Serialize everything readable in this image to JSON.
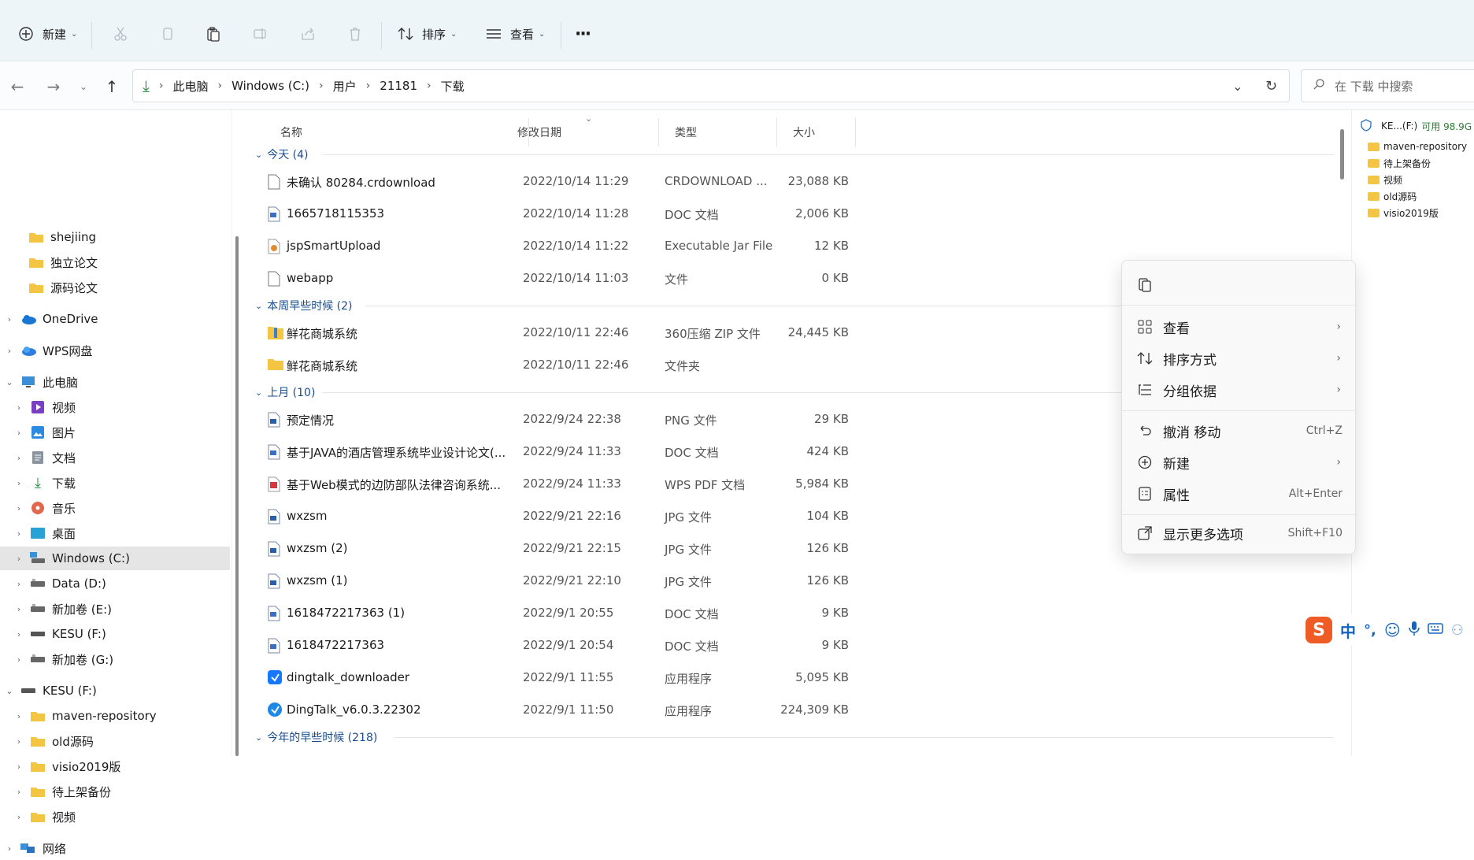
{
  "toolbar": {
    "new_label": "新建",
    "sort_label": "排序",
    "view_label": "查看",
    "more_label": "···"
  },
  "nav": {
    "breadcrumbs": [
      "此电脑",
      "Windows (C:)",
      "用户",
      "21181",
      "下载"
    ],
    "search_placeholder": "在 下载 中搜索"
  },
  "sidebar": {
    "items": [
      {
        "label": "shejiing",
        "icon": "folder-icon"
      },
      {
        "label": "独立论文",
        "icon": "folder-icon"
      },
      {
        "label": "源码论文",
        "icon": "folder-icon"
      },
      {
        "label": "OneDrive",
        "icon": "cloud-icon"
      },
      {
        "label": "WPS网盘",
        "icon": "cloud-icon"
      },
      {
        "label": "此电脑",
        "icon": "computer-icon"
      },
      {
        "label": "视频",
        "icon": "video-icon"
      },
      {
        "label": "图片",
        "icon": "picture-icon"
      },
      {
        "label": "文档",
        "icon": "document-icon"
      },
      {
        "label": "下载",
        "icon": "download-icon"
      },
      {
        "label": "音乐",
        "icon": "music-icon"
      },
      {
        "label": "桌面",
        "icon": "desktop-icon"
      },
      {
        "label": "Windows (C:)",
        "icon": "drive-icon"
      },
      {
        "label": "Data (D:)",
        "icon": "drive-icon"
      },
      {
        "label": "新加卷 (E:)",
        "icon": "drive-icon"
      },
      {
        "label": "KESU  (F:)",
        "icon": "drive-icon"
      },
      {
        "label": "新加卷 (G:)",
        "icon": "drive-icon"
      },
      {
        "label": "KESU  (F:)",
        "icon": "drive-icon"
      },
      {
        "label": "maven-repository",
        "icon": "folder-icon"
      },
      {
        "label": "old源码",
        "icon": "folder-icon"
      },
      {
        "label": "visio2019版",
        "icon": "folder-icon"
      },
      {
        "label": "待上架备份",
        "icon": "folder-icon"
      },
      {
        "label": "视频",
        "icon": "folder-icon"
      },
      {
        "label": "网络",
        "icon": "network-icon"
      }
    ]
  },
  "columns": {
    "name": "名称",
    "date": "修改日期",
    "type": "类型",
    "size": "大小"
  },
  "groups": [
    {
      "label": "今天 (4)"
    },
    {
      "label": "本周早些时候 (2)"
    },
    {
      "label": "上月 (10)"
    },
    {
      "label": "今年的早些时候 (218)"
    }
  ],
  "files": [
    {
      "name": "未确认 80284.crdownload",
      "date": "2022/10/14 11:29",
      "type": "CRDOWNLOAD ...",
      "size": "23,088 KB",
      "icon": "blank-file-icon"
    },
    {
      "name": "1665718115353",
      "date": "2022/10/14 11:28",
      "type": "DOC 文档",
      "size": "2,006 KB",
      "icon": "doc-file-icon"
    },
    {
      "name": "jspSmartUpload",
      "date": "2022/10/14 11:22",
      "type": "Executable Jar File",
      "size": "12 KB",
      "icon": "jar-file-icon"
    },
    {
      "name": "webapp",
      "date": "2022/10/14 11:03",
      "type": "文件",
      "size": "0 KB",
      "icon": "blank-file-icon"
    },
    {
      "name": "鲜花商城系统",
      "date": "2022/10/11 22:46",
      "type": "360压缩 ZIP 文件",
      "size": "24,445 KB",
      "icon": "zip-file-icon"
    },
    {
      "name": "鲜花商城系统",
      "date": "2022/10/11 22:46",
      "type": "文件夹",
      "size": "",
      "icon": "folder-icon"
    },
    {
      "name": "预定情况",
      "date": "2022/9/24 22:38",
      "type": "PNG 文件",
      "size": "29 KB",
      "icon": "image-file-icon"
    },
    {
      "name": "基于JAVA的酒店管理系统毕业设计论文(...",
      "date": "2022/9/24 11:33",
      "type": "DOC 文档",
      "size": "424 KB",
      "icon": "doc-file-icon"
    },
    {
      "name": "基于Web模式的边防部队法律咨询系统...",
      "date": "2022/9/24 11:33",
      "type": "WPS PDF 文档",
      "size": "5,984 KB",
      "icon": "pdf-file-icon"
    },
    {
      "name": "wxzsm",
      "date": "2022/9/21 22:16",
      "type": "JPG 文件",
      "size": "104 KB",
      "icon": "image-file-icon"
    },
    {
      "name": "wxzsm (2)",
      "date": "2022/9/21 22:15",
      "type": "JPG 文件",
      "size": "126 KB",
      "icon": "image-file-icon"
    },
    {
      "name": "wxzsm (1)",
      "date": "2022/9/21 22:10",
      "type": "JPG 文件",
      "size": "126 KB",
      "icon": "image-file-icon"
    },
    {
      "name": "1618472217363 (1)",
      "date": "2022/9/1 20:55",
      "type": "DOC 文档",
      "size": "9 KB",
      "icon": "doc-file-icon"
    },
    {
      "name": "1618472217363",
      "date": "2022/9/1 20:54",
      "type": "DOC 文档",
      "size": "9 KB",
      "icon": "doc-file-icon"
    },
    {
      "name": "dingtalk_downloader",
      "date": "2022/9/1 11:55",
      "type": "应用程序",
      "size": "5,095 KB",
      "icon": "app-icon"
    },
    {
      "name": "DingTalk_v6.0.3.22302",
      "date": "2022/9/1 11:50",
      "type": "应用程序",
      "size": "224,309 KB",
      "icon": "app-icon"
    }
  ],
  "pane": {
    "drive_label": "KE...(F:)",
    "free_label": "可用 98.9G",
    "items": [
      "maven-repository",
      "待上架备份",
      "视频",
      "old源码",
      "visio2019版"
    ]
  },
  "context_menu": {
    "view": "查看",
    "sort": "排序方式",
    "group": "分组依据",
    "undo": "撤消 移动",
    "undo_shortcut": "Ctrl+Z",
    "new": "新建",
    "properties": "属性",
    "properties_shortcut": "Alt+Enter",
    "more": "显示更多选项",
    "more_shortcut": "Shift+F10"
  },
  "ime": {
    "logo": "S",
    "mode": "中"
  },
  "colors": {
    "accent": "#1a4d8f",
    "folder": "#f4c542",
    "selection": "#e5e5e5",
    "toolbar_bg": "#eef5f9"
  }
}
